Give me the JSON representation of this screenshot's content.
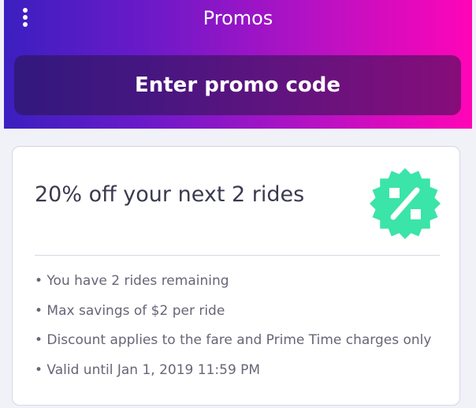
{
  "header": {
    "title": "Promos",
    "menu_icon": "vertical-dots-icon",
    "promo_button_label": "Enter promo code"
  },
  "promo_card": {
    "title": "20% off your next 2 rides",
    "badge_icon": "percent-badge-icon",
    "details": [
      "• You have 2 rides remaining",
      "• Max savings of $2 per ride",
      "• Discount applies to the fare and Prime Time charges only",
      "• Valid until Jan 1, 2019 11:59 PM"
    ]
  },
  "colors": {
    "gradient_start": "#3b1fc0",
    "gradient_end": "#ff05b7",
    "badge": "#3be4a8",
    "title_text": "#3a3a4f",
    "detail_text": "#666677"
  }
}
